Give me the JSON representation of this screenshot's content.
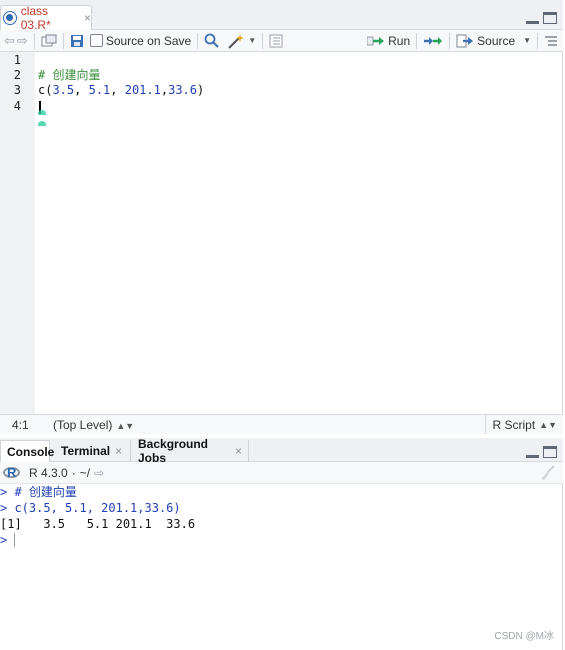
{
  "editor": {
    "tab": {
      "label": "class 03.R*",
      "close": "×"
    },
    "toolbar": {
      "source_on_save_label": "Source on Save",
      "source_on_save_checked": false,
      "run_label": "Run",
      "source_label": "Source"
    },
    "lines": [
      {
        "no": "1",
        "text": ""
      },
      {
        "no": "2",
        "text": "# 创建向量"
      },
      {
        "no": "3",
        "text": "c(3.5, 5.1, 201.1,33.6)"
      },
      {
        "no": "4",
        "text": ""
      }
    ],
    "code_parts": {
      "c": "c(",
      "a": "3.5",
      "sep1": ", ",
      "b": "5.1",
      "sep2": ", ",
      "c2": "201.1",
      "sep3": ",",
      "d": "33.6",
      "close": ")"
    },
    "status": {
      "position": "4:1",
      "scope": "(Top Level)",
      "file_type": "R Script"
    }
  },
  "console": {
    "tabs": [
      {
        "label": "Console",
        "active": true
      },
      {
        "label": "Terminal",
        "close": "×"
      },
      {
        "label": "Background Jobs",
        "close": "×"
      }
    ],
    "path": {
      "version": "R 4.3.0",
      "dot": "·",
      "dir": "~/"
    },
    "lines": [
      {
        "prompt": ">",
        "text": " # 创建向量"
      },
      {
        "prompt": ">",
        "text": " c(3.5, 5.1, 201.1,33.6)"
      },
      {
        "prompt": "",
        "text": "[1]   3.5   5.1 201.1  33.6"
      },
      {
        "prompt": ">",
        "text": ""
      }
    ]
  },
  "watermark": "CSDN @M冰",
  "colors": {
    "tab_modified": "#c0392b",
    "comment": "#3a8f3a",
    "number": "#1f3fb5",
    "console_prompt": "#1f3fb5",
    "run_arrow": "#2aa05a"
  },
  "icons": [
    "r-file-icon",
    "back-arrow-icon",
    "forward-arrow-icon",
    "show-in-window-icon",
    "save-icon",
    "search-icon",
    "magic-wand-icon",
    "outline-icon",
    "run-icon",
    "rerun-icon",
    "source-icon",
    "document-outline-icon",
    "minimize-icon",
    "maximize-icon",
    "r-logo-icon",
    "goto-dir-icon",
    "clear-console-icon"
  ]
}
